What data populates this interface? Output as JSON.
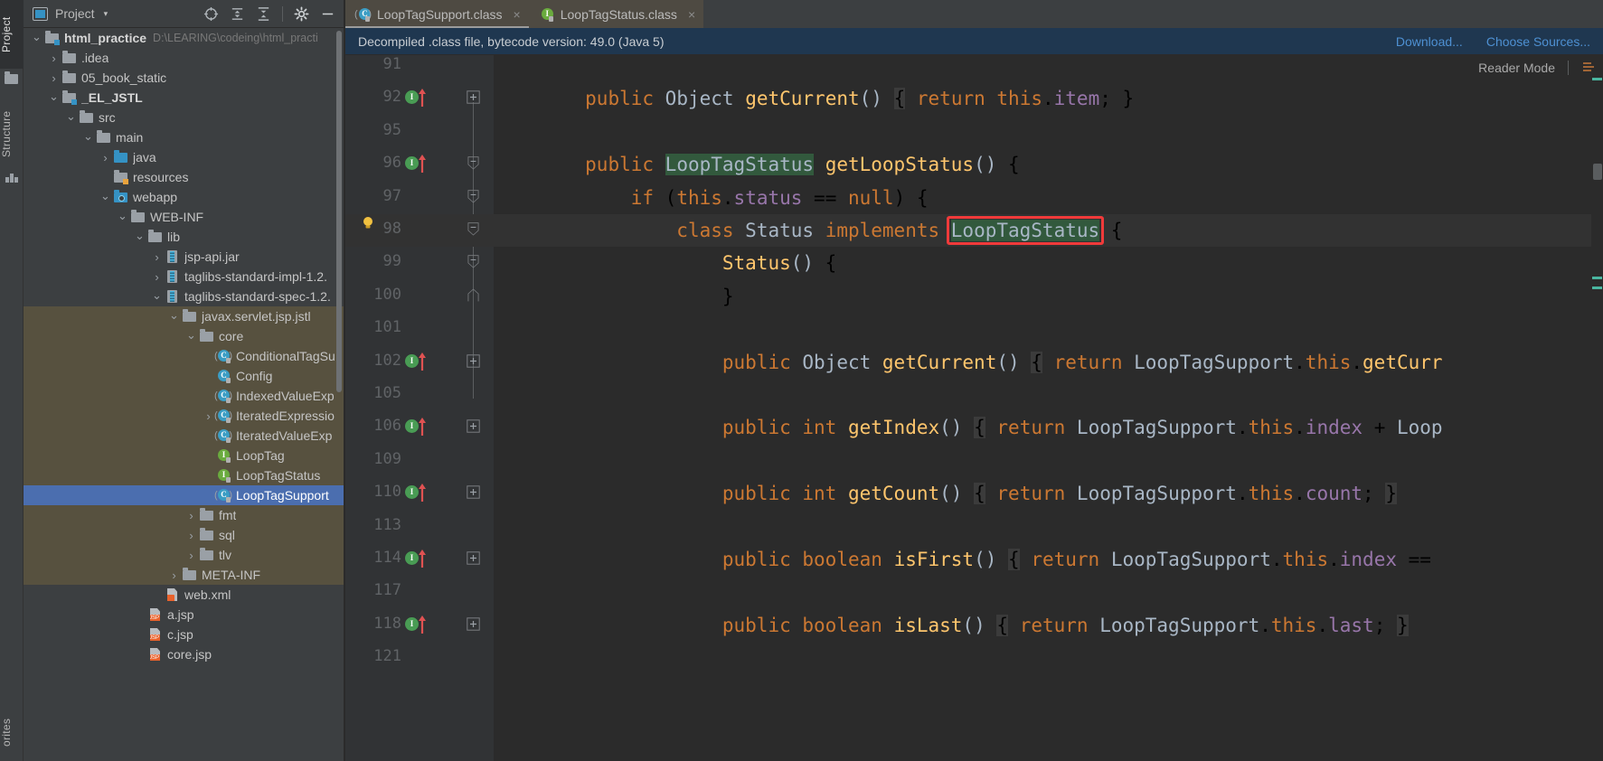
{
  "left_strip": {
    "tabs": [
      {
        "label": "Project",
        "selected": true,
        "icon": "project-folder-icon"
      },
      {
        "label": "Structure",
        "selected": false,
        "icon": "structure-icon"
      },
      {
        "label": "orites",
        "selected": false,
        "icon": "favorites-icon"
      }
    ]
  },
  "project_panel": {
    "title": "Project",
    "caret": "▾",
    "toolbar_icons": [
      "locate-icon",
      "expand-all-icon",
      "collapse-all-icon",
      "settings-gear-icon",
      "hide-icon"
    ],
    "tree": [
      {
        "depth": 0,
        "arrow": "down",
        "icon": "module-folder-icon",
        "label": "html_practice",
        "path": "D:\\LEARING\\codeing\\html_practi",
        "bold": true
      },
      {
        "depth": 1,
        "arrow": "right",
        "icon": "folder-icon",
        "label": ".idea"
      },
      {
        "depth": 1,
        "arrow": "right",
        "icon": "folder-icon",
        "label": "05_book_static"
      },
      {
        "depth": 1,
        "arrow": "down",
        "icon": "module-folder-icon",
        "label": "_EL_JSTL",
        "bold": true
      },
      {
        "depth": 2,
        "arrow": "down",
        "icon": "folder-icon",
        "label": "src"
      },
      {
        "depth": 3,
        "arrow": "down",
        "icon": "folder-icon",
        "label": "main"
      },
      {
        "depth": 4,
        "arrow": "right",
        "icon": "source-folder-icon",
        "label": "java"
      },
      {
        "depth": 4,
        "arrow": "none",
        "icon": "resource-folder-icon",
        "label": "resources"
      },
      {
        "depth": 4,
        "arrow": "down",
        "icon": "webapp-folder-icon",
        "label": "webapp"
      },
      {
        "depth": 5,
        "arrow": "down",
        "icon": "folder-icon",
        "label": "WEB-INF"
      },
      {
        "depth": 6,
        "arrow": "down",
        "icon": "folder-icon",
        "label": "lib"
      },
      {
        "depth": 7,
        "arrow": "right",
        "icon": "jar-icon",
        "label": "jsp-api.jar"
      },
      {
        "depth": 7,
        "arrow": "right",
        "icon": "jar-icon",
        "label": "taglibs-standard-impl-1.2."
      },
      {
        "depth": 7,
        "arrow": "down",
        "icon": "jar-icon",
        "label": "taglibs-standard-spec-1.2."
      },
      {
        "depth": 8,
        "arrow": "down",
        "icon": "folder-icon",
        "label": "javax.servlet.jsp.jstl",
        "highlight": true
      },
      {
        "depth": 9,
        "arrow": "down",
        "icon": "folder-icon",
        "label": "core",
        "highlight": true
      },
      {
        "depth": 10,
        "arrow": "none",
        "icon": "abstract-class-icon",
        "label": "ConditionalTagSu",
        "highlight": true
      },
      {
        "depth": 10,
        "arrow": "none",
        "icon": "class-icon",
        "label": "Config",
        "highlight": true
      },
      {
        "depth": 10,
        "arrow": "none",
        "icon": "abstract-class-icon",
        "label": "IndexedValueExp",
        "highlight": true
      },
      {
        "depth": 10,
        "arrow": "right",
        "icon": "abstract-class-icon",
        "label": "IteratedExpressio",
        "highlight": true
      },
      {
        "depth": 10,
        "arrow": "none",
        "icon": "abstract-class-icon",
        "label": "IteratedValueExp",
        "highlight": true
      },
      {
        "depth": 10,
        "arrow": "none",
        "icon": "interface-icon",
        "label": "LoopTag",
        "highlight": true
      },
      {
        "depth": 10,
        "arrow": "none",
        "icon": "interface-icon",
        "label": "LoopTagStatus",
        "highlight": true
      },
      {
        "depth": 10,
        "arrow": "none",
        "icon": "abstract-class-icon",
        "label": "LoopTagSupport",
        "selected": true
      },
      {
        "depth": 9,
        "arrow": "right",
        "icon": "folder-icon",
        "label": "fmt",
        "highlight": true
      },
      {
        "depth": 9,
        "arrow": "right",
        "icon": "folder-icon",
        "label": "sql",
        "highlight": true
      },
      {
        "depth": 9,
        "arrow": "right",
        "icon": "folder-icon",
        "label": "tlv",
        "highlight": true
      },
      {
        "depth": 8,
        "arrow": "right",
        "icon": "folder-icon",
        "label": "META-INF",
        "highlight": true
      },
      {
        "depth": 7,
        "arrow": "none",
        "icon": "xml-file-icon",
        "label": "web.xml"
      },
      {
        "depth": 6,
        "arrow": "none",
        "icon": "jsp-file-icon",
        "label": "a.jsp"
      },
      {
        "depth": 6,
        "arrow": "none",
        "icon": "jsp-file-icon",
        "label": "c.jsp"
      },
      {
        "depth": 6,
        "arrow": "none",
        "icon": "jsp-file-icon",
        "label": "core.jsp"
      }
    ]
  },
  "editor": {
    "tabs": [
      {
        "label": "LoopTagSupport.class",
        "icon": "abstract-class-icon",
        "active": true,
        "close": "×"
      },
      {
        "label": "LoopTagStatus.class",
        "icon": "interface-icon",
        "active": false,
        "close": "×"
      }
    ],
    "banner": {
      "message": "Decompiled .class file, bytecode version: 49.0 (Java 5)",
      "links": [
        "Download...",
        "Choose Sources..."
      ]
    },
    "reader_mode": "Reader Mode",
    "annotation": {
      "color": "#f03a3a",
      "target_text": "LoopTagStatus"
    },
    "lines": [
      {
        "num": "91",
        "marker": "none",
        "fold": "none",
        "code": ""
      },
      {
        "num": "92",
        "marker": "impl",
        "fold": "plus",
        "code": "        <span class=\"kw\">public</span> <span class=\"type\">Object</span> <span class=\"fn\">getCurrent</span><span class=\"pl\">()</span> <span class=\"brace-hl\">{</span> <span class=\"kw\">return</span> <span class=\"kw\">this</span>.<span class=\"fld\">item</span>; }"
      },
      {
        "num": "95",
        "marker": "none",
        "fold": "none",
        "code": ""
      },
      {
        "num": "96",
        "marker": "impl",
        "fold": "minus",
        "code": "        <span class=\"kw\">public</span> <span class=\"sym-hl type\">LoopTagStatus</span> <span class=\"fn\">getLoopStatus</span><span class=\"pl\">()</span> {"
      },
      {
        "num": "97",
        "marker": "none",
        "fold": "minus",
        "code": "            <span class=\"kw\">if</span> (<span class=\"kw\">this</span>.<span class=\"fld\">status</span> == <span class=\"kw\">null</span>) {"
      },
      {
        "num": "98",
        "marker": "bulb",
        "fold": "minus",
        "code": "                <span class=\"kw\">class</span> <span class=\"type\">Status</span> <span class=\"kw\">implements</span> <span class=\"sym-hl type\">LoopTagStatus</span> {",
        "caret": true
      },
      {
        "num": "99",
        "marker": "none",
        "fold": "minus",
        "code": "                    <span class=\"fn\">Status</span><span class=\"pl\">()</span> {"
      },
      {
        "num": "100",
        "marker": "none",
        "fold": "end",
        "code": "                    }"
      },
      {
        "num": "101",
        "marker": "none",
        "fold": "none",
        "code": ""
      },
      {
        "num": "102",
        "marker": "impl",
        "fold": "plus",
        "code": "                    <span class=\"kw\">public</span> <span class=\"type\">Object</span> <span class=\"fn\">getCurrent</span><span class=\"pl\">()</span> <span class=\"brace-hl\">{</span> <span class=\"kw\">return</span> <span class=\"type\">LoopTagSupport</span>.<span class=\"kw\">this</span>.<span class=\"fn\">getCurr</span>"
      },
      {
        "num": "105",
        "marker": "none",
        "fold": "none",
        "code": ""
      },
      {
        "num": "106",
        "marker": "impl",
        "fold": "plus",
        "code": "                    <span class=\"kw\">public</span> <span class=\"kw\">int</span> <span class=\"fn\">getIndex</span><span class=\"pl\">()</span> <span class=\"brace-hl\">{</span> <span class=\"kw\">return</span> <span class=\"type\">LoopTagSupport</span>.<span class=\"kw\">this</span>.<span class=\"fld\">index</span> + <span class=\"type\">Loop</span>"
      },
      {
        "num": "109",
        "marker": "none",
        "fold": "none",
        "code": ""
      },
      {
        "num": "110",
        "marker": "impl",
        "fold": "plus",
        "code": "                    <span class=\"kw\">public</span> <span class=\"kw\">int</span> <span class=\"fn\">getCount</span><span class=\"pl\">()</span> <span class=\"brace-hl\">{</span> <span class=\"kw\">return</span> <span class=\"type\">LoopTagSupport</span>.<span class=\"kw\">this</span>.<span class=\"fld\">count</span>; <span class=\"brace-hl\">}</span>"
      },
      {
        "num": "113",
        "marker": "none",
        "fold": "none",
        "code": ""
      },
      {
        "num": "114",
        "marker": "impl",
        "fold": "plus",
        "code": "                    <span class=\"kw\">public</span> <span class=\"kw\">boolean</span> <span class=\"fn\">isFirst</span><span class=\"pl\">()</span> <span class=\"brace-hl\">{</span> <span class=\"kw\">return</span> <span class=\"type\">LoopTagSupport</span>.<span class=\"kw\">this</span>.<span class=\"fld\">index</span> =="
      },
      {
        "num": "117",
        "marker": "none",
        "fold": "none",
        "code": ""
      },
      {
        "num": "118",
        "marker": "impl",
        "fold": "plus",
        "code": "                    <span class=\"kw\">public</span> <span class=\"kw\">boolean</span> <span class=\"fn\">isLast</span><span class=\"pl\">()</span> <span class=\"brace-hl\">{</span> <span class=\"kw\">return</span> <span class=\"type\">LoopTagSupport</span>.<span class=\"kw\">this</span>.<span class=\"fld\">last</span>; <span class=\"brace-hl\">}</span>"
      },
      {
        "num": "121",
        "marker": "none",
        "fold": "none",
        "code": ""
      }
    ]
  },
  "colors": {
    "panel_bg": "#3c3f41",
    "editor_bg": "#2b2b2b",
    "gutter_bg": "#313335",
    "selection_blue": "#4b6eaf",
    "library_highlight": "#57513f",
    "banner_bg": "#1f3750",
    "link_blue": "#4e90d2",
    "keyword_orange": "#cc7832",
    "method_yellow": "#ffc66d",
    "identifier": "#a9b7c6",
    "field_purple": "#9876aa",
    "symbol_highlight": "#32593d",
    "annotation_red": "#f03a3a"
  }
}
